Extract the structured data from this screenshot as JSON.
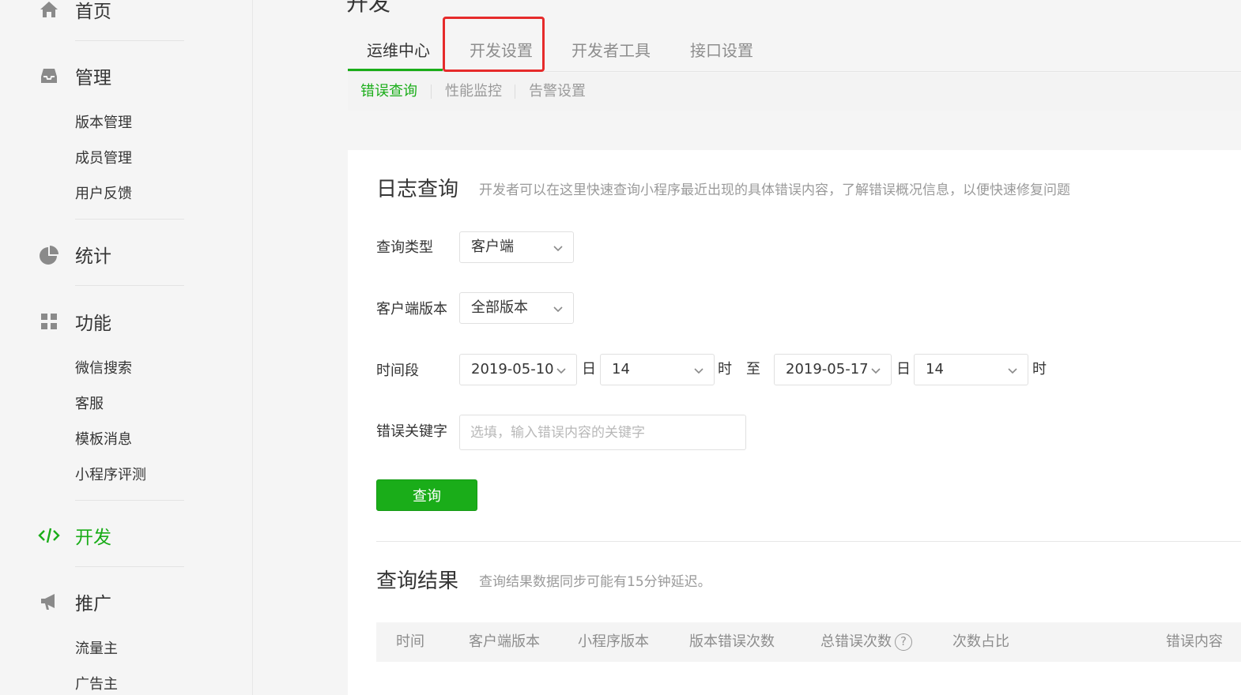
{
  "sidebar": {
    "home": {
      "label": "首页",
      "icon": "home-icon"
    },
    "manage": {
      "label": "管理",
      "icon": "inbox-icon",
      "items": [
        "版本管理",
        "成员管理",
        "用户反馈"
      ]
    },
    "stats": {
      "label": "统计",
      "icon": "pie-chart-icon"
    },
    "features": {
      "label": "功能",
      "icon": "grid-icon",
      "items": [
        "微信搜索",
        "客服",
        "模板消息",
        "小程序评测"
      ]
    },
    "dev": {
      "label": "开发",
      "icon": "code-icon",
      "active": true
    },
    "promote": {
      "label": "推广",
      "icon": "megaphone-icon",
      "items": [
        "流量主",
        "广告主"
      ]
    }
  },
  "page": {
    "title": "开发"
  },
  "tabs": [
    "运维中心",
    "开发设置",
    "开发者工具",
    "接口设置"
  ],
  "active_tab": "运维中心",
  "highlighted_tab": "开发设置",
  "subtabs": [
    "错误查询",
    "性能监控",
    "告警设置"
  ],
  "active_subtab": "错误查询",
  "log_query": {
    "title": "日志查询",
    "desc": "开发者可以在这里快速查询小程序最近出现的具体错误内容，了解错误概况信息，以便快速修复问题",
    "query_type": {
      "label": "查询类型",
      "value": "客户端"
    },
    "client_version": {
      "label": "客户端版本",
      "value": "全部版本"
    },
    "time_range": {
      "label": "时间段",
      "start_date": "2019-05-10",
      "day_unit": "日",
      "start_hour": "14",
      "hour_unit": "时",
      "to": "至",
      "end_date": "2019-05-17",
      "end_hour": "14"
    },
    "keyword": {
      "label": "错误关键字",
      "placeholder": "选填，输入错误内容的关键字",
      "value": ""
    },
    "submit_label": "查询"
  },
  "results": {
    "title": "查询结果",
    "desc": "查询结果数据同步可能有15分钟延迟。",
    "columns": [
      "时间",
      "客户端版本",
      "小程序版本",
      "版本错误次数",
      "总错误次数",
      "次数占比",
      "错误内容"
    ],
    "help_glyph": "?"
  },
  "colors": {
    "accent": "#1aad19",
    "highlight": "#e62b2b"
  }
}
